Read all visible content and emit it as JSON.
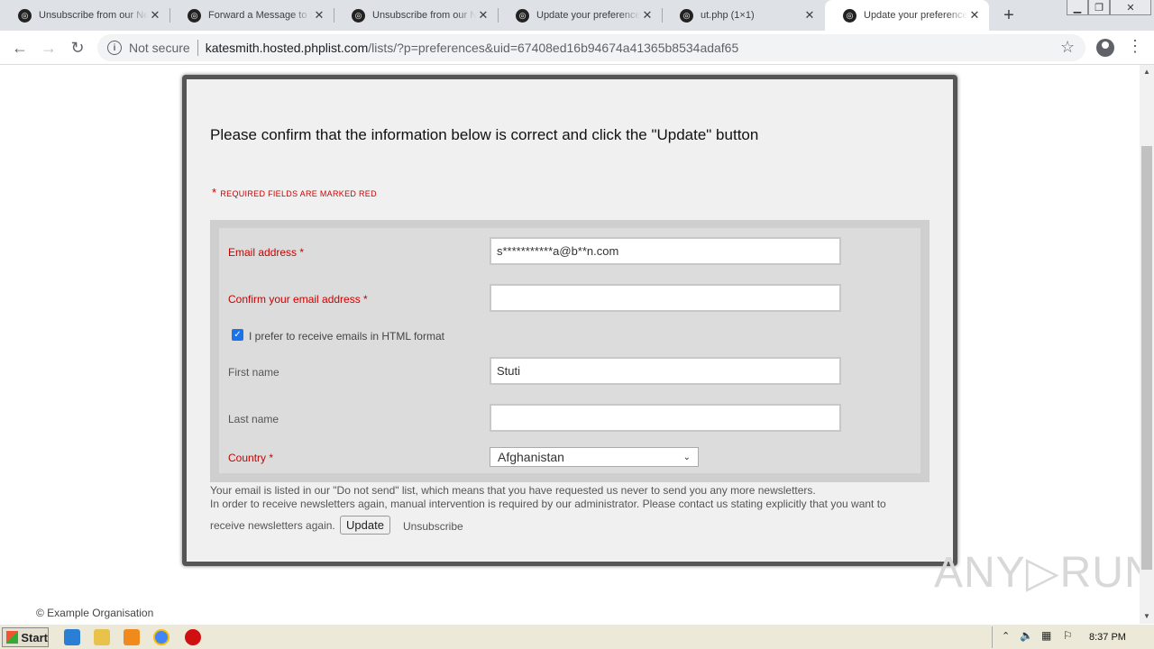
{
  "browser": {
    "tabs": [
      {
        "title": "Unsubscribe from our Ne",
        "active": false
      },
      {
        "title": "Forward a Message to So",
        "active": false
      },
      {
        "title": "Unsubscribe from our Ne",
        "active": false
      },
      {
        "title": "Update your preferences",
        "active": false
      },
      {
        "title": "ut.php (1×1)",
        "active": false
      },
      {
        "title": "Update your preferences",
        "active": true
      }
    ],
    "security_label": "Not secure",
    "url_host": "katesmith.hosted.phplist.com",
    "url_path": "/lists/?p=preferences&uid=67408ed16b94674a41365b8534adaf65"
  },
  "page": {
    "heading": "Please confirm that the information below is correct and click the \"Update\" button",
    "required_note": "REQUIRED FIELDS ARE MARKED RED",
    "required_mark": "*",
    "form": {
      "email_label": "Email address *",
      "email_value": "s***********a@b**n.com",
      "confirm_label": "Confirm your email address *",
      "confirm_value": "",
      "html_pref_label": "I prefer to receive emails in HTML format",
      "html_pref_checked": true,
      "first_name_label": "First name",
      "first_name_value": "Stuti",
      "last_name_label": "Last name",
      "last_name_value": "",
      "country_label": "Country *",
      "country_value": "Afghanistan"
    },
    "message_line1": "Your email is listed in our \"Do not send\" list, which means that you have requested us never to send you any more newsletters.",
    "message_line2": "In order to receive newsletters again, manual intervention is required by our administrator. Please contact us stating explicitly that you want to",
    "message_line3": "receive newsletters again.",
    "update_button": "Update",
    "unsubscribe_link": "Unsubscribe",
    "footer": "© Example Organisation"
  },
  "watermark": "ANY▷RUN",
  "taskbar": {
    "start_label": "Start",
    "clock": "8:37 PM"
  },
  "colors": {
    "required_red": "#cc0000",
    "card_border": "#555555",
    "checkbox_blue": "#1a73e8"
  }
}
